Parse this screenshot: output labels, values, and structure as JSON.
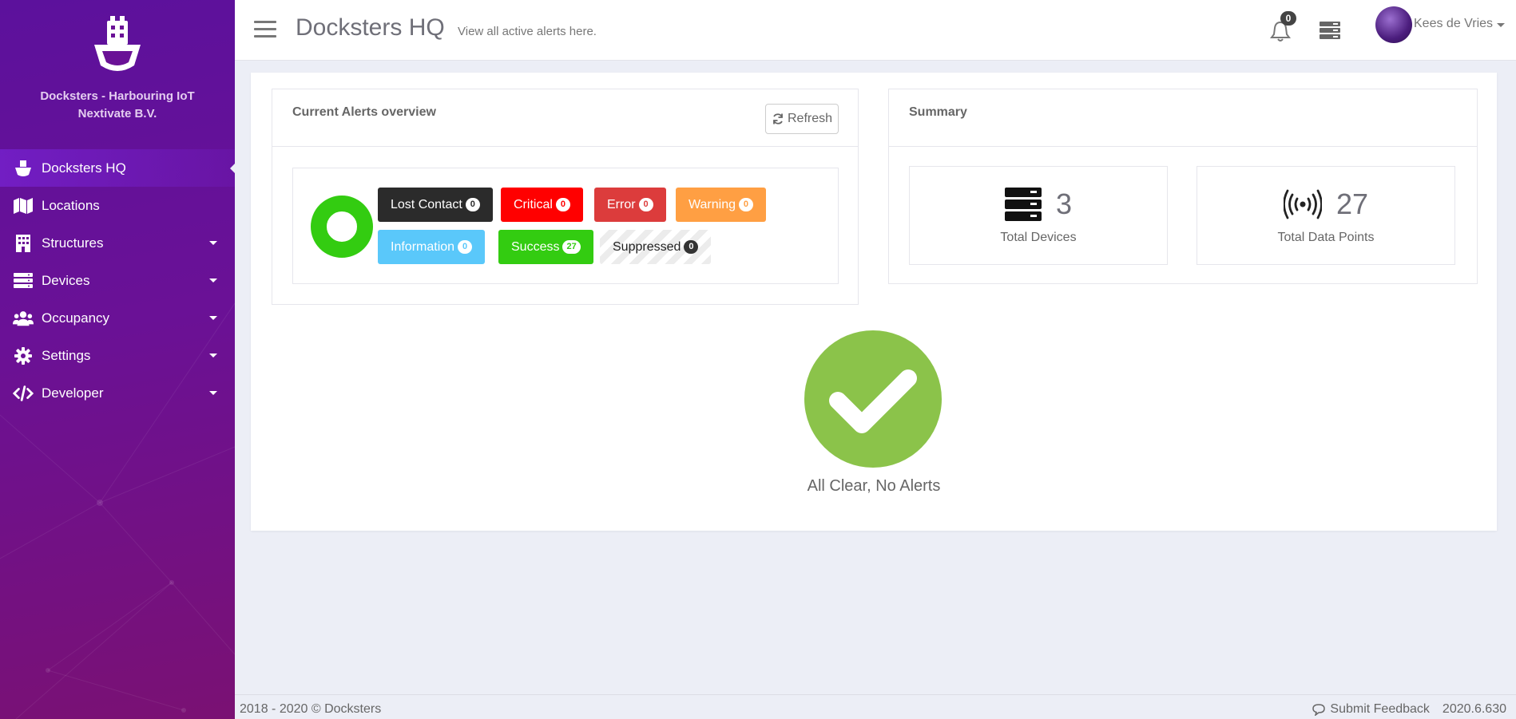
{
  "sidebar": {
    "brand_line1": "Docksters - Harbouring IoT",
    "brand_line2": "Nextivate B.V.",
    "items": [
      {
        "label": "Docksters HQ",
        "icon": "ship-icon",
        "active": true
      },
      {
        "label": "Locations",
        "icon": "map-icon"
      },
      {
        "label": "Structures",
        "icon": "building-icon"
      },
      {
        "label": "Devices",
        "icon": "server-icon"
      },
      {
        "label": "Occupancy",
        "icon": "users-icon"
      },
      {
        "label": "Settings",
        "icon": "gear-icon"
      },
      {
        "label": "Developer",
        "icon": "code-icon"
      }
    ]
  },
  "header": {
    "title": "Docksters HQ",
    "subtitle": "View all active alerts here.",
    "notifications_count": "0",
    "user_name": "Kees de Vries"
  },
  "alerts": {
    "title": "Current Alerts overview",
    "refresh_label": "Refresh",
    "chips": [
      {
        "label": "Lost Contact",
        "count": "0",
        "color": "#2b2b2b"
      },
      {
        "label": "Critical",
        "count": "0",
        "color": "#ff0000"
      },
      {
        "label": "Error",
        "count": "0",
        "color": "#dc3c3c"
      },
      {
        "label": "Warning",
        "count": "0",
        "color": "#ff9f43"
      },
      {
        "label": "Information",
        "count": "0",
        "color": "#5ac8fa"
      },
      {
        "label": "Success",
        "count": "27",
        "color": "#33cc11"
      },
      {
        "label": "Suppressed",
        "count": "0",
        "color": "#f2f2f2"
      }
    ],
    "donut_color": "#33cc11"
  },
  "summary": {
    "title": "Summary",
    "devices_value": "3",
    "devices_label": "Total Devices",
    "datapoints_value": "27",
    "datapoints_label": "Total Data Points"
  },
  "status": {
    "message": "All Clear, No Alerts",
    "color": "#8bc34a"
  },
  "footer": {
    "copyright": "2018 - 2020 © Docksters",
    "feedback": "Submit Feedback",
    "version": "2020.6.630"
  }
}
